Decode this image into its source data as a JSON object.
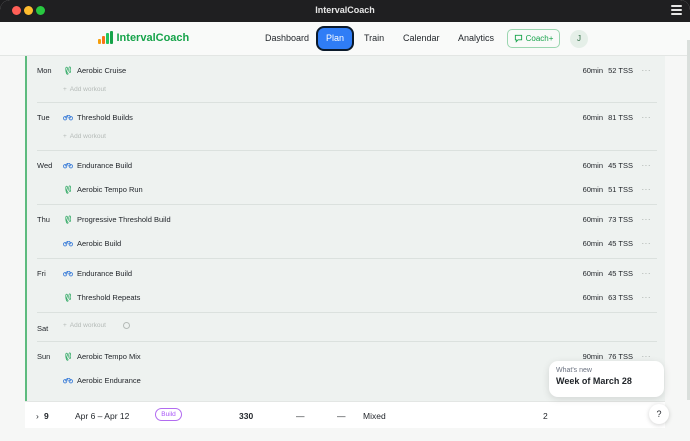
{
  "window": {
    "title": "IntervalCoach"
  },
  "nav": {
    "logo": "IntervalCoach",
    "links": [
      "Dashboard",
      "Plan",
      "Train",
      "Calendar",
      "Analytics"
    ],
    "coach_label": "Coach+",
    "avatar_initial": "J"
  },
  "colors": {
    "accent": "#2f7df6",
    "brand": "#16a34a",
    "bike": "#3b7dd8",
    "run": "#22a45a",
    "badge": "#a855f7"
  },
  "add_workout_label": "Add workout",
  "days": [
    {
      "name": "Mon",
      "workouts": [
        {
          "sport": "run",
          "name": "Aerobic Cruise",
          "duration": "60min",
          "tss": "52 TSS"
        }
      ]
    },
    {
      "name": "Tue",
      "workouts": [
        {
          "sport": "bike",
          "name": "Threshold Builds",
          "duration": "60min",
          "tss": "81 TSS"
        }
      ]
    },
    {
      "name": "Wed",
      "workouts": [
        {
          "sport": "bike",
          "name": "Endurance Build",
          "duration": "60min",
          "tss": "45 TSS"
        },
        {
          "sport": "run",
          "name": "Aerobic Tempo Run",
          "duration": "60min",
          "tss": "51 TSS"
        }
      ]
    },
    {
      "name": "Thu",
      "workouts": [
        {
          "sport": "run",
          "name": "Progressive Threshold Build",
          "duration": "60min",
          "tss": "73 TSS"
        },
        {
          "sport": "bike",
          "name": "Aerobic Build",
          "duration": "60min",
          "tss": "45 TSS"
        }
      ]
    },
    {
      "name": "Fri",
      "workouts": [
        {
          "sport": "bike",
          "name": "Endurance Build",
          "duration": "60min",
          "tss": "45 TSS"
        },
        {
          "sport": "run",
          "name": "Threshold Repeats",
          "duration": "60min",
          "tss": "63 TSS"
        }
      ]
    },
    {
      "name": "Sat",
      "workouts": []
    },
    {
      "name": "Sun",
      "workouts": [
        {
          "sport": "run",
          "name": "Aerobic Tempo Mix",
          "duration": "90min",
          "tss": "76 TSS"
        },
        {
          "sport": "bike",
          "name": "Aerobic Endurance",
          "duration": "",
          "tss": ""
        }
      ]
    }
  ],
  "weeks": [
    {
      "num": "9",
      "range": "Apr 6 – Apr 12",
      "badge": "Build",
      "tss": "330",
      "d1": "—",
      "d2": "—",
      "type": "Mixed",
      "count": "2"
    }
  ],
  "toast": {
    "sub": "What's new",
    "title": "Week of March 28"
  },
  "help_label": "?"
}
